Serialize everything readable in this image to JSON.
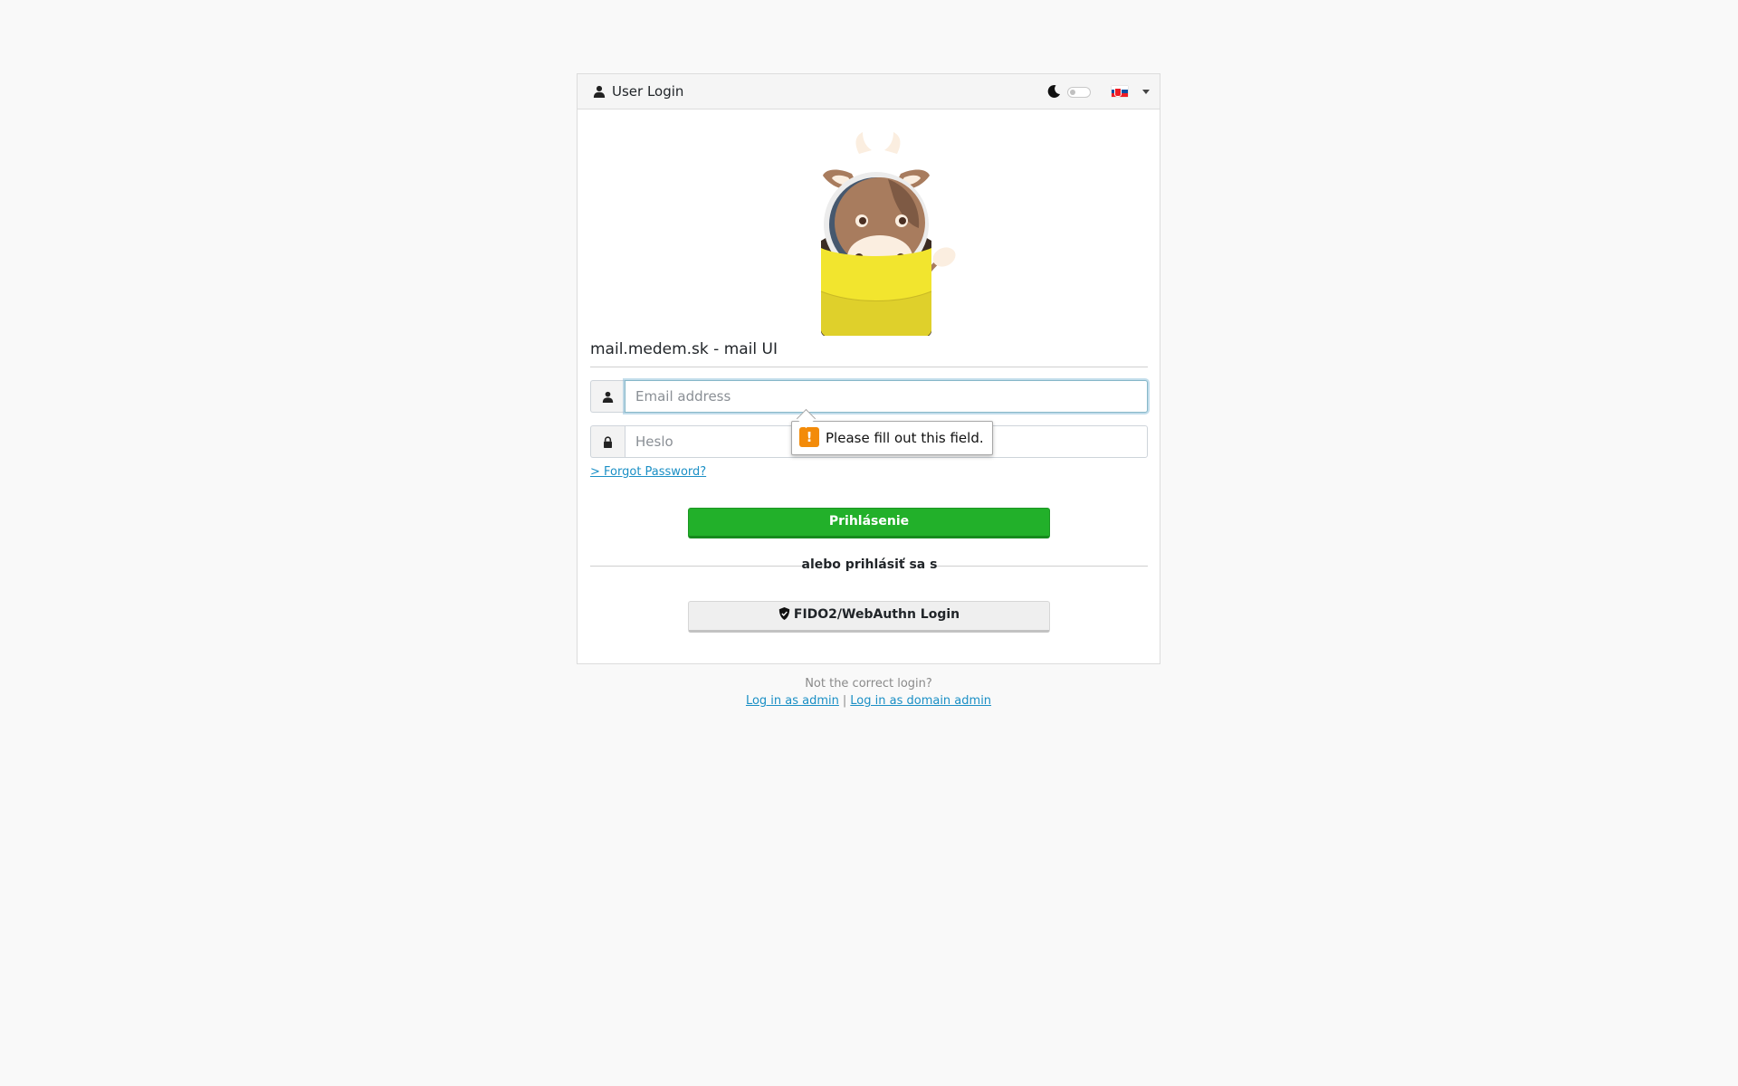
{
  "header": {
    "title": "User Login",
    "user_icon": "user-icon",
    "dark_mode_icon": "moon-icon",
    "dark_mode_enabled": false,
    "language_flag": "slovakia-flag-icon"
  },
  "main": {
    "logo": "mailcow-cow-envelope-logo",
    "site_title": "mail.medem.sk - mail UI",
    "email_placeholder": "Email address",
    "email_value": "",
    "password_placeholder": "Heslo",
    "password_value": "",
    "forgot_password": "> Forgot Password?",
    "login_button": "Prihlásenie",
    "or_login_with": "alebo prihlásiť sa s",
    "fido_button": "FIDO2/WebAuthn Login"
  },
  "validation_tooltip": {
    "message": "Please fill out this field.",
    "icon": "warning-icon",
    "icon_glyph": "!"
  },
  "footer": {
    "note": "Not the correct login?",
    "admin_link": "Log in as admin",
    "separator": "|",
    "domain_admin_link": "Log in as domain admin"
  },
  "colors": {
    "primary_button": "#22b02a",
    "link": "#1a8fc5",
    "warning": "#f38b09",
    "background": "#f9f9f9"
  }
}
